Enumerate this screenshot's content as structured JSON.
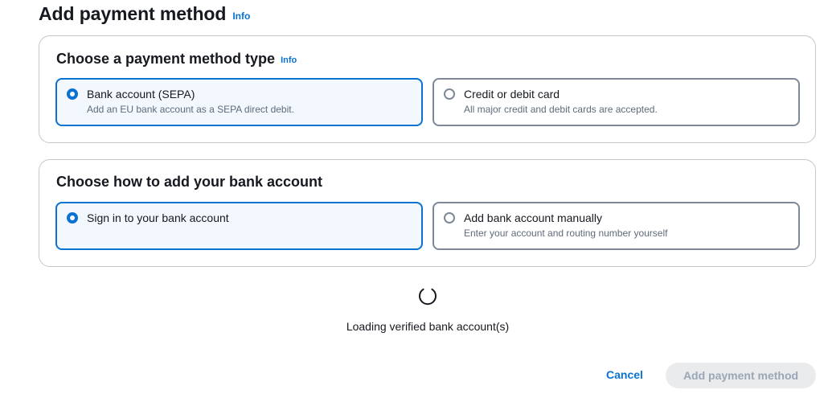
{
  "header": {
    "title": "Add payment method",
    "info": "Info"
  },
  "payment_type": {
    "title": "Choose a payment method type",
    "info": "Info",
    "options": [
      {
        "label": "Bank account (SEPA)",
        "description": "Add an EU bank account as a SEPA direct debit.",
        "selected": true
      },
      {
        "label": "Credit or debit card",
        "description": "All major credit and debit cards are accepted.",
        "selected": false
      }
    ]
  },
  "bank_method": {
    "title": "Choose how to add your bank account",
    "options": [
      {
        "label": "Sign in to your bank account",
        "description": "",
        "selected": true
      },
      {
        "label": "Add bank account manually",
        "description": "Enter your account and routing number yourself",
        "selected": false
      }
    ]
  },
  "loading": {
    "text": "Loading verified bank account(s)",
    "icon": "spinner-icon"
  },
  "footer": {
    "cancel_label": "Cancel",
    "submit_label": "Add payment method"
  },
  "colors": {
    "accent": "#0972d3",
    "selected_bg": "#f2f8fd",
    "disabled_bg": "#e9ebed",
    "disabled_text": "#9ba7b6"
  }
}
